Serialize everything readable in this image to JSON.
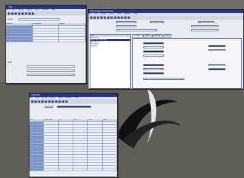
{
  "window_left": {
    "title": "Jobs",
    "menu": [
      "File",
      "Edit",
      "Record",
      "Query",
      "Tools",
      "Window",
      "Help"
    ],
    "section_label": "Journal",
    "table_headers": [
      "Number",
      "Description",
      "Status"
    ],
    "rows": [
      {
        "col1": "",
        "col2": "",
        "col3": ""
      },
      {
        "col1": "",
        "col2": "",
        "col3": ""
      },
      {
        "col1": "",
        "col2": "",
        "col3": ""
      },
      {
        "col1": "",
        "col2": "",
        "col3": ""
      },
      {
        "col1": "",
        "col2": "",
        "col3": ""
      },
      {
        "col1": "",
        "col2": "",
        "col3": ""
      }
    ],
    "lower_label": "Detail"
  },
  "window_right": {
    "title": "Maintenance Work Order",
    "menu": [
      "File",
      "Edit",
      "Record",
      "Query",
      "Tools",
      "Window",
      "Help"
    ],
    "left_panel_header": "Tree",
    "list_items": [
      "Equipment",
      "Maintenance Planning",
      "Work Orders",
      "Purchasing",
      "Inventory"
    ],
    "tabs": [
      "General",
      "Labor",
      "Materials",
      "Tools"
    ]
  },
  "window_bottom": {
    "title": "Materials",
    "menu": [
      "File",
      "Edit",
      "Record",
      "Query",
      "Tools",
      "Window",
      "Help"
    ],
    "table_headers": [
      "Item",
      "Description",
      "Qty",
      "Unit",
      "Cost",
      "Total"
    ],
    "rows_count_note": ""
  }
}
